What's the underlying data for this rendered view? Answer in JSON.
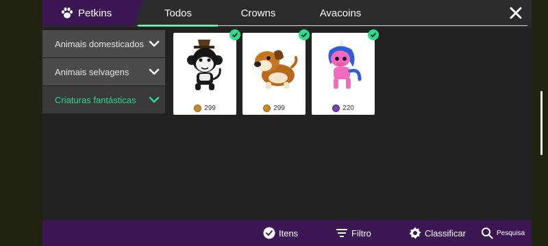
{
  "header": {
    "brand_label": "Petkins",
    "tabs": [
      {
        "label": "Todos",
        "active": true
      },
      {
        "label": "Crowns",
        "active": false
      },
      {
        "label": "Avacoins",
        "active": false
      }
    ]
  },
  "sidebar": {
    "items": [
      {
        "label": "Animais domesticados",
        "active": false
      },
      {
        "label": "Animais selvagens",
        "active": false
      },
      {
        "label": "Criaturas fantásticas",
        "active": true
      }
    ]
  },
  "items": [
    {
      "name": "monkey-pet",
      "price": "299",
      "currency": "crowns-icon",
      "owned": true
    },
    {
      "name": "dog-pet",
      "price": "299",
      "currency": "crowns-icon",
      "owned": true
    },
    {
      "name": "unicorn-pet",
      "price": "220",
      "currency": "avacoins-icon",
      "owned": true
    }
  ],
  "bottom_bar": {
    "itens_label": "Itens",
    "filtro_label": "Filtro",
    "classificar_label": "Classificar",
    "pesquisa_label": "Pesquisa"
  },
  "colors": {
    "accent": "#2fe09a",
    "brand_purple": "#3d1654",
    "panel_bg": "#222222"
  }
}
